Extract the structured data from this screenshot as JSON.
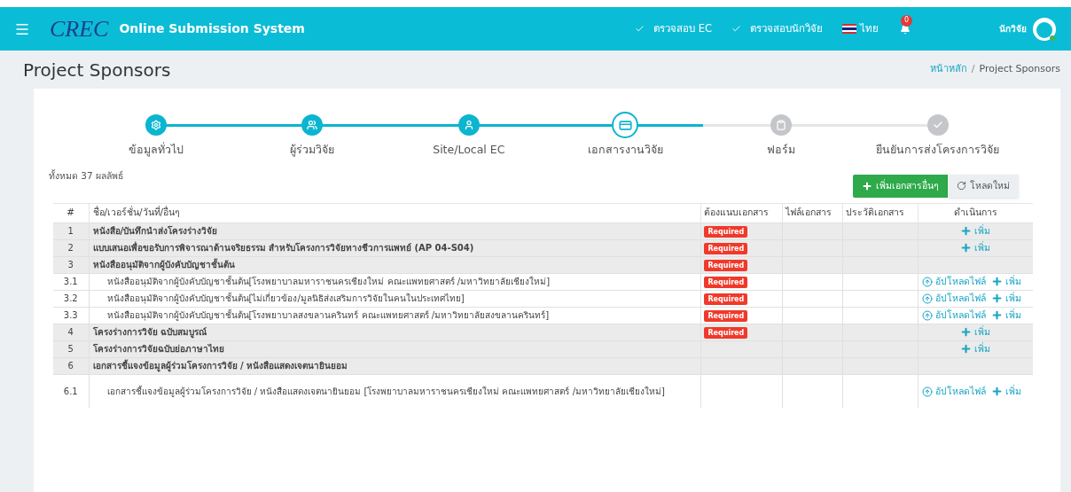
{
  "navbar": {
    "logo": "CREC",
    "app_title": "Online Submission System",
    "links": [
      {
        "label": "ตรวจสอบ EC"
      },
      {
        "label": "ตรวจสอบนักวิจัย"
      }
    ],
    "language": "ไทย",
    "notifications": "0",
    "user": "นักวิจัย"
  },
  "page": {
    "title": "Project Sponsors",
    "breadcrumb": [
      {
        "label": "หน้าหลัก",
        "selected": false
      },
      {
        "label": "Project Sponsors",
        "selected": true
      }
    ],
    "breadcrumb_separator": "/"
  },
  "steps": [
    {
      "label": "ข้อมูลทั่วไป",
      "kind": "done"
    },
    {
      "label": "ผู้ร่วมวิจัย",
      "kind": "done"
    },
    {
      "label": "Site/Local EC",
      "kind": "done"
    },
    {
      "label": "เอกสารงานวิจัย",
      "kind": "current"
    },
    {
      "label": "ฟอร์ม",
      "kind": "pending"
    },
    {
      "label": "ยืนยันการส่งโครงการวิจัย",
      "kind": "pending"
    }
  ],
  "result_count": "ทั้งหมด 37 ผลลัพธ์",
  "buttons": [
    {
      "kind": "add",
      "label": "เพิ่มเอกสารอื่นๆ"
    },
    {
      "kind": "reload",
      "label": "โหลดใหม่"
    }
  ],
  "table": {
    "columns": [
      "#",
      "ชื่อ/เวอร์ชั่น/วันที่/อื่นๆ",
      "ต้องแนบเอกสาร",
      "ไฟล์เอกสาร",
      "ประวัติเอกสาร",
      "ดำเนินการ"
    ],
    "rows": [
      {
        "kind": "group",
        "no": "1",
        "name": "หนังสือ/บันทึกนำส่งโครงร่างวิจัย",
        "required": "Required",
        "actions": [
          {
            "kind": "add",
            "label": "เพิ่ม"
          }
        ]
      },
      {
        "kind": "group",
        "no": "2",
        "name": "แบบเสนอเพื่อขอรับการพิจารณาด้านจริยธรรม สำหรับโครงการวิจัยทางชีวการแพทย์ (AP 04-S04)",
        "required": "Required",
        "actions": [
          {
            "kind": "add",
            "label": "เพิ่ม"
          }
        ]
      },
      {
        "kind": "group",
        "no": "3",
        "name": "หนังสืออนุมัติจากผู้บังคับบัญชาชั้นต้น",
        "required": "Required",
        "actions": []
      },
      {
        "kind": "item",
        "no": "3.1",
        "name": "หนังสืออนุมัติจากผู้บังคับบัญชาชั้นต้น[โรงพยาบาลมหาราชนครเชียงใหม่ คณะแพทยศาสตร์ /มหาวิทยาลัยเชียงใหม่]",
        "required": "Required",
        "actions": [
          {
            "kind": "upload",
            "label": "อัปโหลดไฟล์"
          },
          {
            "kind": "add",
            "label": "เพิ่ม"
          }
        ]
      },
      {
        "kind": "item",
        "no": "3.2",
        "name": "หนังสืออนุมัติจากผู้บังคับบัญชาชั้นต้น[ไม่เกี่ยวข้อง/มูลนิธิส่งเสริมการวิจัยในคนในประเทศไทย]",
        "required": "Required",
        "actions": [
          {
            "kind": "upload",
            "label": "อัปโหลดไฟล์"
          },
          {
            "kind": "add",
            "label": "เพิ่ม"
          }
        ]
      },
      {
        "kind": "item",
        "no": "3.3",
        "name": "หนังสืออนุมัติจากผู้บังคับบัญชาชั้นต้น[โรงพยาบาลสงขลานครินทร์ คณะแพทยศาสตร์ /มหาวิทยาลัยสงขลานครินทร์]",
        "required": "Required",
        "actions": [
          {
            "kind": "upload",
            "label": "อัปโหลดไฟล์"
          },
          {
            "kind": "add",
            "label": "เพิ่ม"
          }
        ]
      },
      {
        "kind": "group",
        "no": "4",
        "name": "โครงร่างการวิจัย ฉบับสมบูรณ์",
        "required": "Required",
        "actions": [
          {
            "kind": "add",
            "label": "เพิ่ม"
          }
        ]
      },
      {
        "kind": "group",
        "no": "5",
        "name": "โครงร่างการวิจัยฉบับย่อภาษาไทย",
        "actions": [
          {
            "kind": "add",
            "label": "เพิ่ม"
          }
        ]
      },
      {
        "kind": "group",
        "no": "6",
        "name": "เอกสารชี้แจงข้อมูลผู้ร่วมโครงการวิจัย / หนังสือแสดงเจตนายินยอม",
        "actions": []
      },
      {
        "kind": "item",
        "no": "6.1",
        "name": "เอกสารชี้แจงข้อมูลผู้ร่วมโครงการวิจัย / หนังสือแสดงเจตนายินยอม [โรงพยาบาลมหาราชนครเชียงใหม่ คณะแพทยศาสตร์ /มหาวิทยาลัยเชียงใหม่]",
        "actions": [
          {
            "kind": "upload",
            "label": "อัปโหลดไฟล์"
          },
          {
            "kind": "add",
            "label": "เพิ่ม"
          }
        ]
      }
    ]
  }
}
